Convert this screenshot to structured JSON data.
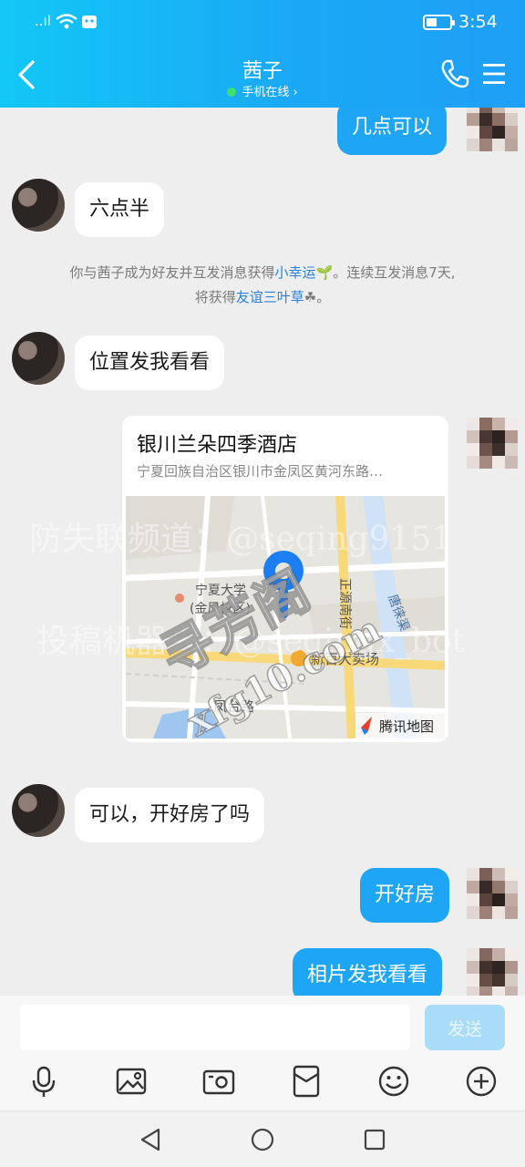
{
  "status_bar": {
    "signal_text": "..ıl",
    "time": "3:54",
    "battery_level": 0.45
  },
  "header": {
    "title": "茜子",
    "presence": "手机在线 ›"
  },
  "messages": {
    "m1": "几点可以",
    "m2": "六点半",
    "m3": "位置发我看看",
    "m4": "可以，开好房了吗",
    "m5": "开好房",
    "m6": "相片发我看看"
  },
  "notice": {
    "line1_a": "你与茜子成为好友并互发消息获得",
    "line1_link": "小幸运",
    "line1_b": "🌱。连续互发消息7天,",
    "line2_a": "将获得",
    "line2_link": "友谊三叶草",
    "line2_b": "☘。"
  },
  "location": {
    "name": "银川兰朵四季酒店",
    "address": "宁夏回族自治区银川市金凤区黄河东路…",
    "map_labels": {
      "university": "宁夏大学",
      "campus": "(金凤校区)",
      "mall": "新百大卖场",
      "road1": "凤台路",
      "road2": "正源南街",
      "canal": "唐徕渠",
      "brand": "腾讯地图"
    }
  },
  "watermark": {
    "line1": "防失联频道：@seqing9151",
    "line2": "投稿机器人：@seqingx_bot",
    "site1": "寻芳阁",
    "site2": "xfg10.com"
  },
  "composer": {
    "placeholder": "",
    "send_label": "发送"
  },
  "colors": {
    "header_start": "#12c7f6",
    "header_end": "#1e9ff6",
    "bubble_out": "#1ea5f4",
    "link": "#2a82d8",
    "send_disabled": "#a9dcf8"
  },
  "icons": {
    "toolbar": [
      "microphone-icon",
      "image-icon",
      "camera-icon",
      "red-packet-icon",
      "emoji-icon",
      "plus-icon"
    ],
    "nav": [
      "back-triangle-icon",
      "home-circle-icon",
      "recents-square-icon"
    ]
  }
}
